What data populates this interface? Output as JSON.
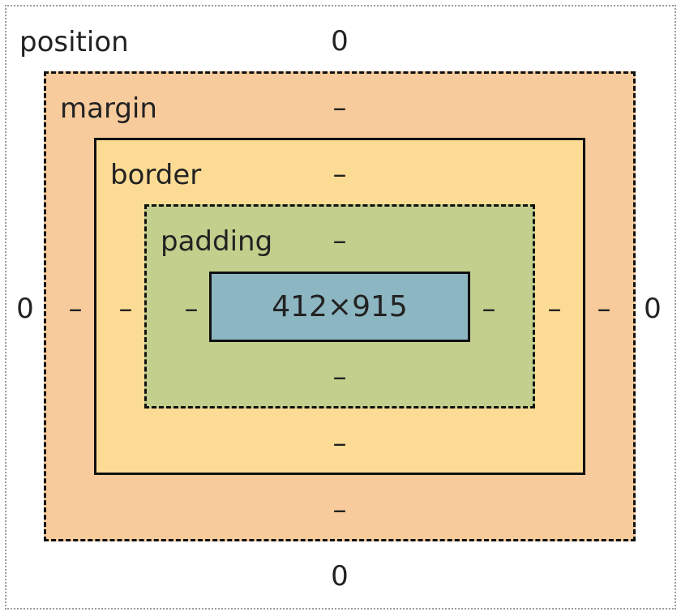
{
  "position": {
    "label": "position",
    "top": "0",
    "right": "0",
    "bottom": "0",
    "left": "0"
  },
  "margin": {
    "label": "margin",
    "top": "–",
    "right": "–",
    "bottom": "–",
    "left": "–"
  },
  "border": {
    "label": "border",
    "top": "–",
    "right": "–",
    "bottom": "–",
    "left": "–"
  },
  "padding": {
    "label": "padding",
    "top": "–",
    "right": "–",
    "bottom": "–",
    "left": "–"
  },
  "content": {
    "size": "412×915"
  },
  "colors": {
    "position_background": "#ffffff",
    "margin_background": "#f8cb9c",
    "border_background": "#fcdc94",
    "padding_background": "#c2cf8d",
    "content_background": "#8cb6c1"
  }
}
